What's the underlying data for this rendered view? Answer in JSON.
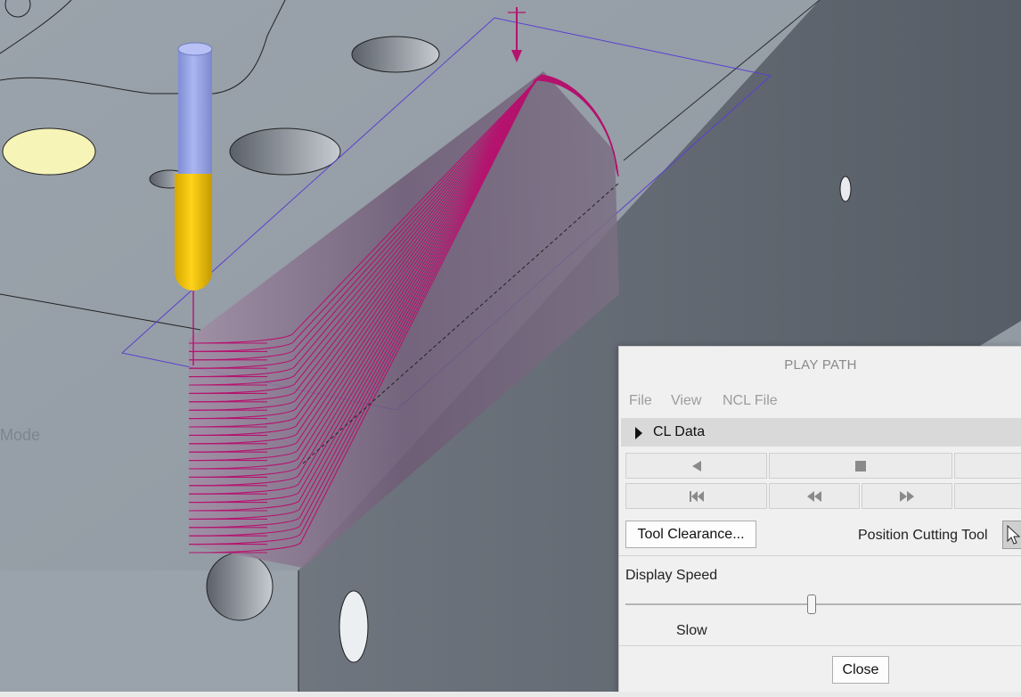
{
  "viewport": {
    "mode_label": "Mode",
    "colors": {
      "background": "#9aa2ab",
      "top_face": "#98a0a8",
      "side_face": "#5b626b",
      "toolpath": "#b5136e",
      "fixture_outline": "#5b3fd0",
      "tool_shank": "#9aa8e8",
      "tool_cutter": "#f1c400"
    }
  },
  "dialog": {
    "title": "PLAY PATH",
    "menu": [
      "File",
      "View",
      "NCL File"
    ],
    "section": {
      "label": "CL Data",
      "icon": "triangle-right-icon"
    },
    "playback_row1": [
      {
        "name": "play-reverse-button",
        "icon": "play-reverse-icon"
      },
      {
        "name": "stop-button",
        "icon": "stop-icon"
      },
      {
        "name": "play-forward-button",
        "icon": "play-forward-icon"
      }
    ],
    "playback_row2": [
      {
        "name": "goto-start-button",
        "icon": "skip-start-icon"
      },
      {
        "name": "step-back-button",
        "icon": "rewind-icon"
      },
      {
        "name": "step-forward-button",
        "icon": "fast-forward-icon"
      },
      {
        "name": "goto-end-button",
        "icon": "skip-end-icon"
      }
    ],
    "tool_clearance_label": "Tool Clearance...",
    "position_cutting_tool_label": "Position Cutting Tool",
    "position_icon": "cursor-icon",
    "display_speed_label": "Display Speed",
    "speed_value": 0.47,
    "slow_label": "Slow",
    "close_label": "Close"
  }
}
